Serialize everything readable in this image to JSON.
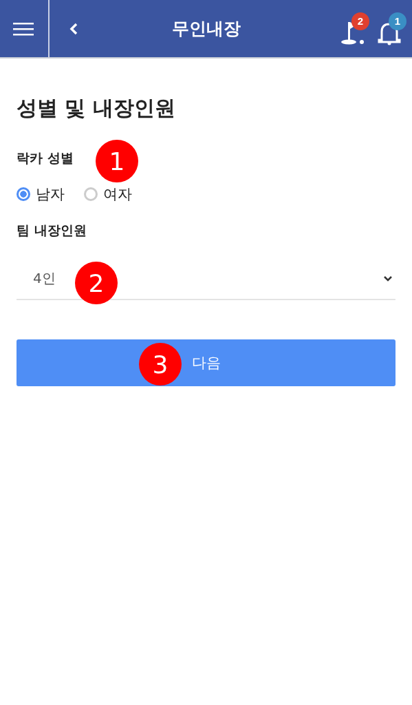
{
  "header": {
    "title": "무인내장",
    "badges": [
      {
        "kind": "flag",
        "count": "2",
        "color": "#e0402f"
      },
      {
        "kind": "bell",
        "count": "1",
        "color": "#3a8fc4"
      }
    ]
  },
  "heading": "성별 및 내장인원",
  "gender": {
    "label": "락카 성별",
    "options": [
      {
        "label": "남자",
        "selected": true
      },
      {
        "label": "여자",
        "selected": false
      }
    ]
  },
  "team": {
    "label": "팀 내장인원",
    "value": "4인"
  },
  "next_button": "다음",
  "callouts": [
    "1",
    "2",
    "3"
  ]
}
